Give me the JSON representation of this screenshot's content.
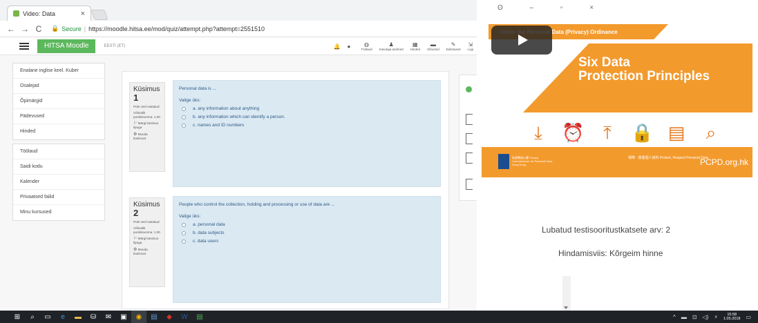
{
  "browser": {
    "tab_title": "Video: Data",
    "tab_close": "×",
    "nav_back": "←",
    "nav_forward": "→",
    "nav_reload": "C",
    "lock_icon": "🔒",
    "secure_label": "Secure",
    "url_separator": "|",
    "url": "https://moodle.hitsa.ee/mod/quiz/attempt.php?attempt=2551510"
  },
  "moodle": {
    "brand": "HITSA Moodle",
    "language": "EESTI (ET)",
    "nav_items": [
      {
        "icon": "◍",
        "label": "Töölaud"
      },
      {
        "icon": "♟",
        "label": "Kasutaja andmed"
      },
      {
        "icon": "▦",
        "label": "Hinded"
      },
      {
        "icon": "▬",
        "label": "Sõnumid"
      },
      {
        "icon": "✎",
        "label": "Eelistused"
      },
      {
        "icon": "⇲",
        "label": "Logi"
      }
    ]
  },
  "sidebar": {
    "group1": [
      "Enalane inglise keel. Kuber",
      "Osalejad",
      "Õpimärgid",
      "Pädevused",
      "Hinded"
    ],
    "group2": [
      "Töölaud",
      "Saidi kodu",
      "Kalender",
      "Privaatsed failid",
      "Minu kursused"
    ]
  },
  "questions": [
    {
      "label": "Küsimus",
      "number": "1",
      "status": "Pole veel vastatud",
      "points": "Võimalik punktisumma: 1.00",
      "flag": "Märgi küsimus lipuga",
      "edit": "Muuda küsimust",
      "text": "Personal data is ...",
      "prompt": "Valige üks:",
      "options": [
        "a. any information about anything",
        "b. any information which can identify a person.",
        "c. names and ID numbers"
      ]
    },
    {
      "label": "Küsimus",
      "number": "2",
      "status": "Pole veel vastatud",
      "points": "Võimalik punktisumma: 1.00",
      "flag": "Märgi küsimus lipuga",
      "edit": "Muuda küsimust",
      "text": "People who control the collection, holding and processing or use of data are ...",
      "prompt": "Valige üks:",
      "options": [
        "a. personal data",
        "b. data subjects",
        "c. data users"
      ]
    }
  ],
  "video": {
    "banner": "Under the Personal Data (Privacy) Ordinance",
    "title_line1": "Six Data",
    "title_line2": "Protection Principles",
    "icons": [
      "⤓",
      "⏰",
      "⤒",
      "🔒",
      "▤",
      "⌕"
    ],
    "footer_logo_text": "私隱專員公署 Privacy Commissioner for Personal Data, Hong Kong",
    "footer_cn": "保障 · 尊重個人資料 Protect, Respect Personal Data",
    "footer_url": "PCPD.org.hk"
  },
  "quiz_info": {
    "attempts": "Lubatud testisooritustkatsete arv: 2",
    "grading": "Hindamisviis: Kõrgeim hinne"
  },
  "taskbar": {
    "icons": [
      "⊞",
      "⌕",
      "▭",
      "e",
      "▬",
      "⛁",
      "✉",
      "▣",
      "◉",
      "▤",
      "◆",
      "W",
      "▤"
    ],
    "tray": [
      "^",
      "▬",
      "⊡",
      "◁)",
      "⚡"
    ],
    "time": "15:58",
    "date": "1.05.2018",
    "notif": "▭"
  }
}
